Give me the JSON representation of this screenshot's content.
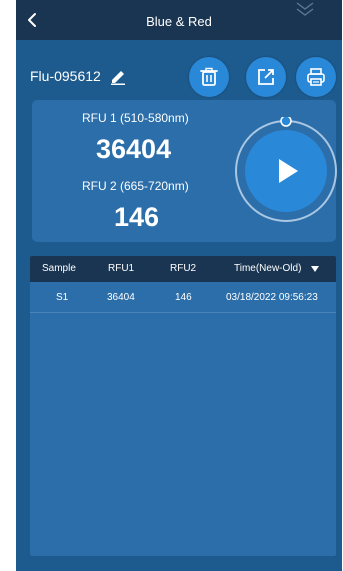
{
  "header": {
    "title": "Blue & Red",
    "back_icon": "chevron-left-icon",
    "expand_icon": "double-chevron-icon"
  },
  "device": {
    "name": "Flu-095612",
    "edit_icon": "pencil-icon"
  },
  "toolbar": {
    "delete_icon": "trash-icon",
    "export_icon": "export-icon",
    "print_icon": "printer-icon"
  },
  "readings": {
    "rfu1_label": "RFU 1 (510-580nm)",
    "rfu1_value": "36404",
    "rfu2_label": "RFU 2 (665-720nm)",
    "rfu2_value": "146",
    "play_icon": "play-icon"
  },
  "table": {
    "columns": [
      "Sample",
      "RFU1",
      "RFU2",
      "Time(New-Old)"
    ],
    "sort_icon": "sort-down-icon",
    "rows": [
      {
        "sample": "S1",
        "rfu1": "36404",
        "rfu2": "146",
        "time": "03/18/2022 09:56:23"
      }
    ]
  },
  "colors": {
    "background": "#1d5a8d",
    "topbar": "#1a3552",
    "panel": "#2b6ea9",
    "accent": "#2a88d9",
    "header_row": "#1a3552"
  }
}
